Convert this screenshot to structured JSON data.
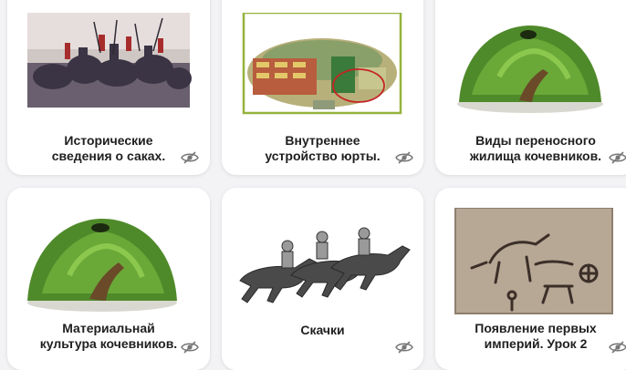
{
  "cards": [
    {
      "title": "Исторические\nсведения о саках.",
      "icon": "eye-slash-icon"
    },
    {
      "title": "Внутреннее\nустройство юрты.",
      "icon": "eye-slash-icon"
    },
    {
      "title": "Виды переносного\nжилища кочевников.",
      "icon": "eye-slash-icon"
    },
    {
      "title": "Материальнай\nкультура кочевников.",
      "icon": "eye-slash-icon"
    },
    {
      "title": "Скачки",
      "icon": "eye-slash-icon"
    },
    {
      "title": "Появление первых\nимперий. Урок 2",
      "icon": "eye-slash-icon"
    }
  ]
}
